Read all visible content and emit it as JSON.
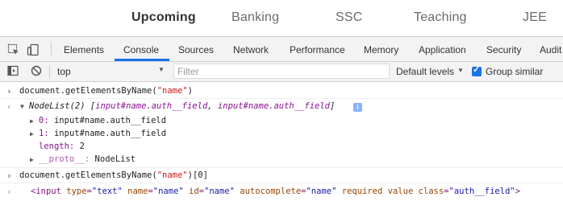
{
  "site_nav": {
    "items": [
      "Upcoming",
      "Banking",
      "SSC",
      "Teaching",
      "JEE"
    ]
  },
  "devtools": {
    "tabs": [
      "Elements",
      "Console",
      "Sources",
      "Network",
      "Performance",
      "Memory",
      "Application",
      "Security",
      "Audit"
    ],
    "active_tab": "Console"
  },
  "toolbar": {
    "context": "top",
    "filter_placeholder": "Filter",
    "levels": "Default levels",
    "group_similar": "Group similar",
    "group_similar_checked": true
  },
  "console": {
    "cmd1": {
      "pre": "document.getElementsByName(",
      "arg": "\"name\"",
      "post": ")"
    },
    "result1": {
      "type": "NodeList(2) [",
      "item_a": "input#name.auth__field",
      "comma": ", ",
      "item_b": "input#name.auth__field",
      "close": "]",
      "info": "i"
    },
    "entries": [
      {
        "key": "0:",
        "value": "input#name.auth__field"
      },
      {
        "key": "1:",
        "value": "input#name.auth__field"
      }
    ],
    "length": {
      "key": "length:",
      "value": "2"
    },
    "proto": {
      "key": "__proto__:",
      "value": "NodeList"
    },
    "cmd2": {
      "pre": "document.getElementsByName(",
      "arg": "\"name\"",
      "post": ")[0]"
    },
    "result2": {
      "open": "<input",
      "attrs": [
        {
          "name": "type",
          "value": "\"text\""
        },
        {
          "name": "name",
          "value": "\"name\""
        },
        {
          "name": "id",
          "value": "\"name\""
        },
        {
          "name": "autocomplete",
          "value": "\"name\""
        },
        {
          "name": "required",
          "value": ""
        },
        {
          "name": "value",
          "value": ""
        },
        {
          "name": "class",
          "value": "\"auth__field\""
        }
      ],
      "close": ">"
    }
  },
  "colors": {
    "accent": "#1a73e8",
    "string": "#c41a16",
    "property": "#881391"
  }
}
